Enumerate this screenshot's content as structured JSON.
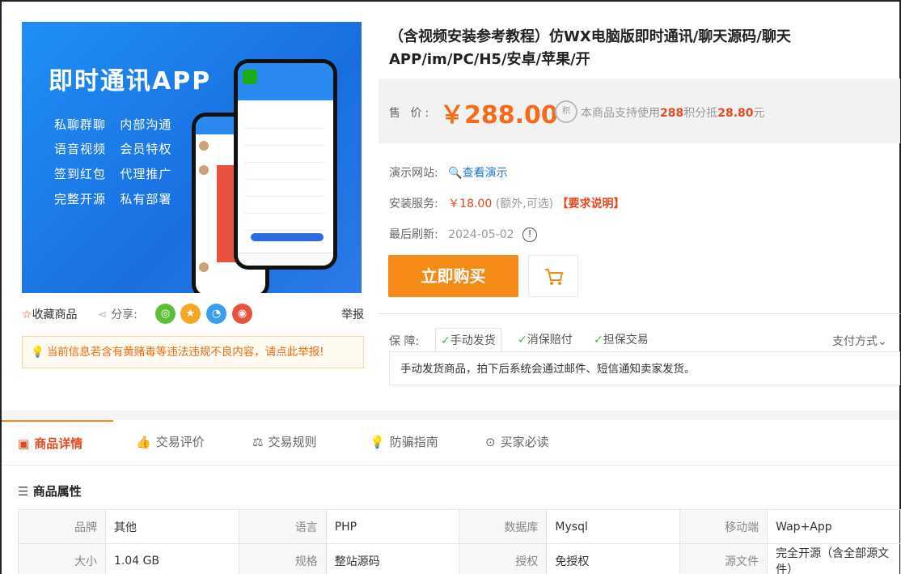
{
  "hero": {
    "title": "即时通讯APP",
    "features": [
      "私聊群聊",
      "内部沟通",
      "语音视频",
      "会员特权",
      "签到红包",
      "代理推广",
      "完整开源",
      "私有部署"
    ]
  },
  "actions": {
    "favorite": "收藏商品",
    "share": "分享:",
    "report": "举报"
  },
  "warning": "当前信息若含有黄赌毒等违法违规不良内容，请点此举报!",
  "product": {
    "title": "（含视频安装参考教程）仿WX电脑版即时通讯/聊天源码/聊天APP/im/PC/H5/安卓/苹果/开",
    "price_label": "售 价:",
    "price": "￥288.00",
    "points_prefix": "本商品支持使用",
    "points_value": "288",
    "points_mid": "积分抵",
    "points_amount": "28.80",
    "points_suffix": "元",
    "points_icon": "积"
  },
  "info": {
    "demo_label": "演示网站:",
    "demo_link": "查看演示",
    "install_label": "安装服务:",
    "install_price": "￥18.00",
    "install_note": "(额外,可选)",
    "install_req": "【要求说明】",
    "refresh_label": "最后刷新:",
    "refresh_date": "2024-05-02"
  },
  "buttons": {
    "buy": "立即购买"
  },
  "guarantee": {
    "label": "保 障:",
    "items": [
      "手动发货",
      "消保赔付",
      "担保交易"
    ],
    "payment": "支付方式",
    "desc": "手动发货商品，拍下后系统会通过邮件、短信通知卖家发货。"
  },
  "tabs": [
    "商品详情",
    "交易评价",
    "交易规则",
    "防骗指南",
    "买家必读"
  ],
  "attributes": {
    "title": "商品属性",
    "rows": [
      [
        [
          "品牌",
          "其他"
        ],
        [
          "语言",
          "PHP"
        ],
        [
          "数据库",
          "Mysql"
        ],
        [
          "移动端",
          "Wap+App"
        ]
      ],
      [
        [
          "大小",
          "1.04 GB"
        ],
        [
          "规格",
          "整站源码"
        ],
        [
          "授权",
          "免授权"
        ],
        [
          "源文件",
          "完全开源（含全部源文件）"
        ]
      ]
    ]
  },
  "colors": {
    "accent": "#f58a17",
    "price": "#f56b1a",
    "red": "#e5471f",
    "link": "#1a73d6"
  }
}
